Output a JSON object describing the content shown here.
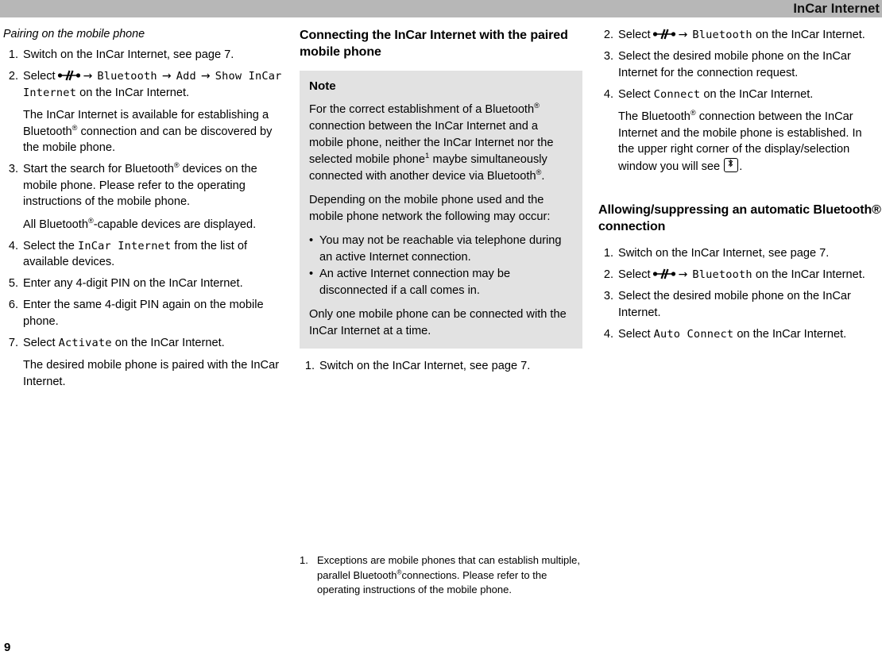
{
  "header": {
    "title": "InCar Internet"
  },
  "page_number": "9",
  "icons": {
    "controller": "controller-knob-icon",
    "bluetooth_boxed": "bluetooth-icon"
  },
  "column1": {
    "subheading": "Pairing on the mobile phone",
    "steps": [
      {
        "num": "1.",
        "parts": [
          {
            "type": "text",
            "value": "Switch on the InCar Internet, see page 7."
          }
        ]
      },
      {
        "num": "2.",
        "parts": [
          {
            "type": "text",
            "value": "Select"
          },
          {
            "type": "icon",
            "value": "controller"
          },
          {
            "type": "arrow",
            "value": "→"
          },
          {
            "type": "mono",
            "value": "Bluetooth"
          },
          {
            "type": "arrow",
            "value": "→"
          },
          {
            "type": "mono",
            "value": "Add"
          },
          {
            "type": "arrow",
            "value": "→"
          },
          {
            "type": "mono",
            "value": "Show InCar Internet"
          },
          {
            "type": "text",
            "value": "on the InCar Internet."
          }
        ],
        "continuation": "The InCar Internet is available for establishing a Bluetooth® connection and can be discovered by the mobile phone."
      },
      {
        "num": "3.",
        "parts": [
          {
            "type": "text",
            "value": "Start the search for Bluetooth® devices on the mobile phone. Please refer to the operating instructions of the mobile phone."
          }
        ],
        "continuation": "All Bluetooth®-capable devices are displayed."
      },
      {
        "num": "4.",
        "parts": [
          {
            "type": "text",
            "value": "Select the"
          },
          {
            "type": "mono",
            "value": "InCar Internet"
          },
          {
            "type": "text",
            "value": "from the list of available devices."
          }
        ]
      },
      {
        "num": "5.",
        "parts": [
          {
            "type": "text",
            "value": "Enter any 4-digit PIN on the InCar Internet."
          }
        ]
      },
      {
        "num": "6.",
        "parts": [
          {
            "type": "text",
            "value": "Enter the same 4-digit PIN again on the mobile phone."
          }
        ]
      },
      {
        "num": "7.",
        "parts": [
          {
            "type": "text",
            "value": "Select"
          },
          {
            "type": "mono",
            "value": "Activate"
          },
          {
            "type": "text",
            "value": "on the InCar Internet."
          }
        ],
        "continuation": "The desired mobile phone is paired with the InCar Internet."
      }
    ]
  },
  "column2": {
    "heading": "Connecting the InCar Internet with the paired mobile phone",
    "note": {
      "title": "Note",
      "paragraph1": "For the correct establishment of a Bluetooth® connection between the InCar Internet and a mobile phone, neither the InCar Internet nor the selected mobile phone¹ maybe simultaneously connected with another device via Bluetooth®.",
      "paragraph2": "Depending on the mobile phone used and the mobile phone network the following may occur:",
      "bullets": [
        "You may not be reachable via telephone during an active Internet connection.",
        "An active Internet connection may be disconnected if a call comes in."
      ],
      "paragraph3": "Only one mobile phone can be connected with the InCar Internet at a time."
    },
    "steps": [
      {
        "num": "1.",
        "parts": [
          {
            "type": "text",
            "value": "Switch on the InCar Internet, see page 7."
          }
        ]
      }
    ],
    "footnote": {
      "num": "1.",
      "text": "Exceptions are mobile phones that can establish multiple, parallel Bluetooth®connections. Please refer to the operating instructions of the mobile phone."
    }
  },
  "column3": {
    "steps_top": [
      {
        "num": "2.",
        "parts": [
          {
            "type": "text",
            "value": "Select"
          },
          {
            "type": "icon",
            "value": "controller"
          },
          {
            "type": "arrow",
            "value": "→"
          },
          {
            "type": "mono",
            "value": "Bluetooth"
          },
          {
            "type": "text",
            "value": "on the InCar Internet."
          }
        ]
      },
      {
        "num": "3.",
        "parts": [
          {
            "type": "text",
            "value": "Select the desired mobile phone on the InCar Internet for the connection request."
          }
        ]
      },
      {
        "num": "4.",
        "parts": [
          {
            "type": "text",
            "value": "Select"
          },
          {
            "type": "mono",
            "value": "Connect"
          },
          {
            "type": "text",
            "value": "on the InCar Internet."
          }
        ],
        "continuation_pre": "The Bluetooth® connection between the InCar Internet and the mobile phone is established. In the upper right corner of the display/selection window you will see ",
        "continuation_post": "."
      }
    ],
    "heading": "Allowing/suppressing an automatic Bluetooth® connection",
    "steps_bottom": [
      {
        "num": "1.",
        "parts": [
          {
            "type": "text",
            "value": "Switch on the InCar Internet, see page 7."
          }
        ]
      },
      {
        "num": "2.",
        "parts": [
          {
            "type": "text",
            "value": "Select"
          },
          {
            "type": "icon",
            "value": "controller"
          },
          {
            "type": "arrow",
            "value": "→"
          },
          {
            "type": "mono",
            "value": "Bluetooth"
          },
          {
            "type": "text",
            "value": "on the InCar Internet."
          }
        ]
      },
      {
        "num": "3.",
        "parts": [
          {
            "type": "text",
            "value": "Select the desired mobile phone on the InCar Internet."
          }
        ]
      },
      {
        "num": "4.",
        "parts": [
          {
            "type": "text",
            "value": "Select"
          },
          {
            "type": "mono",
            "value": "Auto Connect"
          },
          {
            "type": "text",
            "value": "on the InCar Internet."
          }
        ]
      }
    ]
  }
}
